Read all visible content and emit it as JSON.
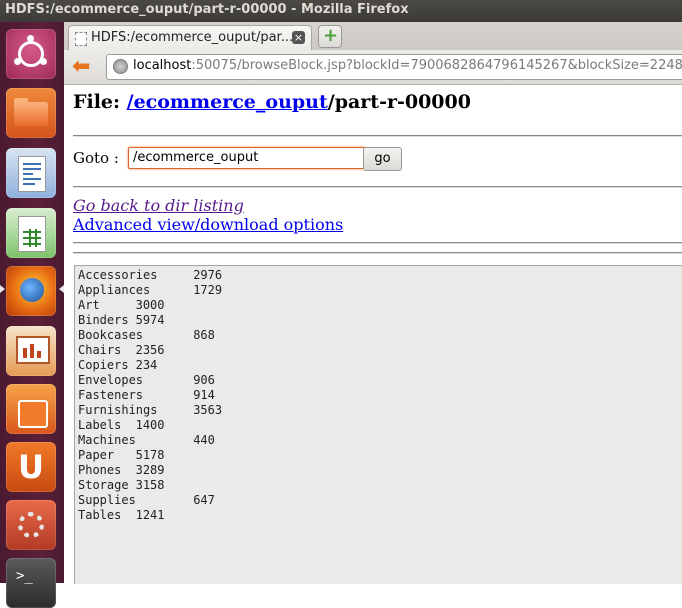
{
  "window": {
    "title": "HDFS:/ecommerce_ouput/part-r-00000 - Mozilla Firefox"
  },
  "launcher": {
    "items": [
      "ubuntu-dash",
      "files",
      "libreoffice-writer",
      "libreoffice-calc",
      "firefox",
      "libreoffice-impress",
      "ubuntu-software-center",
      "ubuntu-one",
      "system-settings",
      "terminal"
    ]
  },
  "browser": {
    "tab_title": "HDFS:/ecommerce_ouput/par...",
    "tab_close": "×",
    "new_tab": "+",
    "url_host": "localhost",
    "url_rest": ":50075/browseBlock.jsp?blockId=7900682864796145267&blockSize=2248"
  },
  "page": {
    "file_label": "File: ",
    "file_dir_link": "/ecommerce_ouput",
    "file_name": "/part-r-00000",
    "goto_label": "Goto :",
    "goto_value": "/ecommerce_ouput",
    "go_button": "go",
    "back_link": "Go back to dir listing",
    "advanced_link": "Advanced view/download options"
  },
  "file_contents": [
    {
      "category": "Accessories",
      "sep": "     ",
      "count": "2976"
    },
    {
      "category": "Appliances",
      "sep": "      ",
      "count": "1729"
    },
    {
      "category": "Art",
      "sep": "     ",
      "count": "3000"
    },
    {
      "category": "Binders",
      "sep": " ",
      "count": "5974"
    },
    {
      "category": "Bookcases",
      "sep": "       ",
      "count": "868"
    },
    {
      "category": "Chairs",
      "sep": "  ",
      "count": "2356"
    },
    {
      "category": "Copiers",
      "sep": " ",
      "count": "234"
    },
    {
      "category": "Envelopes",
      "sep": "       ",
      "count": "906"
    },
    {
      "category": "Fasteners",
      "sep": "       ",
      "count": "914"
    },
    {
      "category": "Furnishings",
      "sep": "     ",
      "count": "3563"
    },
    {
      "category": "Labels",
      "sep": "  ",
      "count": "1400"
    },
    {
      "category": "Machines",
      "sep": "        ",
      "count": "440"
    },
    {
      "category": "Paper",
      "sep": "   ",
      "count": "5178"
    },
    {
      "category": "Phones",
      "sep": "  ",
      "count": "3289"
    },
    {
      "category": "Storage",
      "sep": " ",
      "count": "3158"
    },
    {
      "category": "Supplies",
      "sep": "        ",
      "count": "647"
    },
    {
      "category": "Tables",
      "sep": "  ",
      "count": "1241"
    }
  ]
}
